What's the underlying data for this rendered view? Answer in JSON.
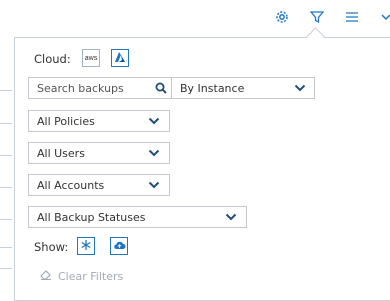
{
  "top_toolbar": {
    "icons": [
      "gear-icon",
      "filter-icon",
      "menu-icon",
      "chevron-down-icon"
    ]
  },
  "filters": {
    "cloud_label": "Cloud:",
    "cloud_buttons": [
      "aws-icon",
      "azure-icon"
    ],
    "search": {
      "placeholder": "Search backups"
    },
    "instance_select": "By Instance",
    "policies_select": "All Policies",
    "users_select": "All Users",
    "accounts_select": "All Accounts",
    "statuses_select": "All Backup Statuses",
    "show_label": "Show:",
    "show_buttons": [
      "snowflake-icon",
      "cloud-backup-icon"
    ],
    "clear_filters": "Clear Filters"
  },
  "colors": {
    "accent": "#1f77c4",
    "border": "#c3c9cf",
    "muted": "#a3abb3"
  }
}
